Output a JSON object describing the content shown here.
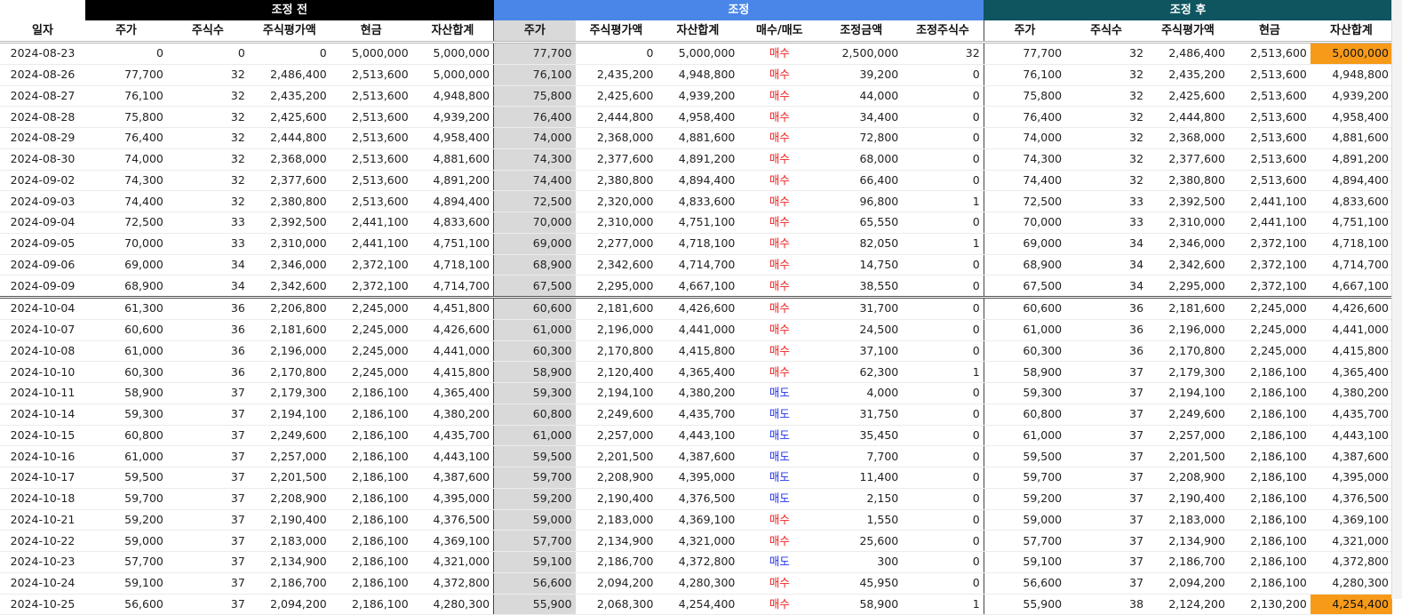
{
  "groups": {
    "before": "조정 전",
    "adjust": "조정",
    "after": "조정 후"
  },
  "headers": [
    "일자",
    "주가",
    "주식수",
    "주식평가액",
    "현금",
    "자산합계",
    "주가",
    "주식평가액",
    "자산합계",
    "매수/매도",
    "조정금액",
    "조정주식수",
    "주가",
    "주식수",
    "주식평가액",
    "현금",
    "자산합계"
  ],
  "colors": {
    "buy": "#ee2222",
    "sell": "#2233ee",
    "highlight": "#f79a1a",
    "group_before": "#000000",
    "group_adjust": "#4a86e8",
    "group_after": "#0e5560"
  },
  "rows": [
    [
      "2024-08-23",
      "0",
      "0",
      "0",
      "5,000,000",
      "5,000,000",
      "77,700",
      "0",
      "5,000,000",
      "매수",
      "2,500,000",
      "32",
      "77,700",
      "32",
      "2,486,400",
      "2,513,600",
      "5,000,000"
    ],
    [
      "2024-08-26",
      "77,700",
      "32",
      "2,486,400",
      "2,513,600",
      "5,000,000",
      "76,100",
      "2,435,200",
      "4,948,800",
      "매수",
      "39,200",
      "0",
      "76,100",
      "32",
      "2,435,200",
      "2,513,600",
      "4,948,800"
    ],
    [
      "2024-08-27",
      "76,100",
      "32",
      "2,435,200",
      "2,513,600",
      "4,948,800",
      "75,800",
      "2,425,600",
      "4,939,200",
      "매수",
      "44,000",
      "0",
      "75,800",
      "32",
      "2,425,600",
      "2,513,600",
      "4,939,200"
    ],
    [
      "2024-08-28",
      "75,800",
      "32",
      "2,425,600",
      "2,513,600",
      "4,939,200",
      "76,400",
      "2,444,800",
      "4,958,400",
      "매수",
      "34,400",
      "0",
      "76,400",
      "32",
      "2,444,800",
      "2,513,600",
      "4,958,400"
    ],
    [
      "2024-08-29",
      "76,400",
      "32",
      "2,444,800",
      "2,513,600",
      "4,958,400",
      "74,000",
      "2,368,000",
      "4,881,600",
      "매수",
      "72,800",
      "0",
      "74,000",
      "32",
      "2,368,000",
      "2,513,600",
      "4,881,600"
    ],
    [
      "2024-08-30",
      "74,000",
      "32",
      "2,368,000",
      "2,513,600",
      "4,881,600",
      "74,300",
      "2,377,600",
      "4,891,200",
      "매수",
      "68,000",
      "0",
      "74,300",
      "32",
      "2,377,600",
      "2,513,600",
      "4,891,200"
    ],
    [
      "2024-09-02",
      "74,300",
      "32",
      "2,377,600",
      "2,513,600",
      "4,891,200",
      "74,400",
      "2,380,800",
      "4,894,400",
      "매수",
      "66,400",
      "0",
      "74,400",
      "32",
      "2,380,800",
      "2,513,600",
      "4,894,400"
    ],
    [
      "2024-09-03",
      "74,400",
      "32",
      "2,380,800",
      "2,513,600",
      "4,894,400",
      "72,500",
      "2,320,000",
      "4,833,600",
      "매수",
      "96,800",
      "1",
      "72,500",
      "33",
      "2,392,500",
      "2,441,100",
      "4,833,600"
    ],
    [
      "2024-09-04",
      "72,500",
      "33",
      "2,392,500",
      "2,441,100",
      "4,833,600",
      "70,000",
      "2,310,000",
      "4,751,100",
      "매수",
      "65,550",
      "0",
      "70,000",
      "33",
      "2,310,000",
      "2,441,100",
      "4,751,100"
    ],
    [
      "2024-09-05",
      "70,000",
      "33",
      "2,310,000",
      "2,441,100",
      "4,751,100",
      "69,000",
      "2,277,000",
      "4,718,100",
      "매수",
      "82,050",
      "1",
      "69,000",
      "34",
      "2,346,000",
      "2,372,100",
      "4,718,100"
    ],
    [
      "2024-09-06",
      "69,000",
      "34",
      "2,346,000",
      "2,372,100",
      "4,718,100",
      "68,900",
      "2,342,600",
      "4,714,700",
      "매수",
      "14,750",
      "0",
      "68,900",
      "34",
      "2,342,600",
      "2,372,100",
      "4,714,700"
    ],
    [
      "2024-09-09",
      "68,900",
      "34",
      "2,342,600",
      "2,372,100",
      "4,714,700",
      "67,500",
      "2,295,000",
      "4,667,100",
      "매수",
      "38,550",
      "0",
      "67,500",
      "34",
      "2,295,000",
      "2,372,100",
      "4,667,100"
    ],
    [
      "2024-10-04",
      "61,300",
      "36",
      "2,206,800",
      "2,245,000",
      "4,451,800",
      "60,600",
      "2,181,600",
      "4,426,600",
      "매수",
      "31,700",
      "0",
      "60,600",
      "36",
      "2,181,600",
      "2,245,000",
      "4,426,600"
    ],
    [
      "2024-10-07",
      "60,600",
      "36",
      "2,181,600",
      "2,245,000",
      "4,426,600",
      "61,000",
      "2,196,000",
      "4,441,000",
      "매수",
      "24,500",
      "0",
      "61,000",
      "36",
      "2,196,000",
      "2,245,000",
      "4,441,000"
    ],
    [
      "2024-10-08",
      "61,000",
      "36",
      "2,196,000",
      "2,245,000",
      "4,441,000",
      "60,300",
      "2,170,800",
      "4,415,800",
      "매수",
      "37,100",
      "0",
      "60,300",
      "36",
      "2,170,800",
      "2,245,000",
      "4,415,800"
    ],
    [
      "2024-10-10",
      "60,300",
      "36",
      "2,170,800",
      "2,245,000",
      "4,415,800",
      "58,900",
      "2,120,400",
      "4,365,400",
      "매수",
      "62,300",
      "1",
      "58,900",
      "37",
      "2,179,300",
      "2,186,100",
      "4,365,400"
    ],
    [
      "2024-10-11",
      "58,900",
      "37",
      "2,179,300",
      "2,186,100",
      "4,365,400",
      "59,300",
      "2,194,100",
      "4,380,200",
      "매도",
      "4,000",
      "0",
      "59,300",
      "37",
      "2,194,100",
      "2,186,100",
      "4,380,200"
    ],
    [
      "2024-10-14",
      "59,300",
      "37",
      "2,194,100",
      "2,186,100",
      "4,380,200",
      "60,800",
      "2,249,600",
      "4,435,700",
      "매도",
      "31,750",
      "0",
      "60,800",
      "37",
      "2,249,600",
      "2,186,100",
      "4,435,700"
    ],
    [
      "2024-10-15",
      "60,800",
      "37",
      "2,249,600",
      "2,186,100",
      "4,435,700",
      "61,000",
      "2,257,000",
      "4,443,100",
      "매도",
      "35,450",
      "0",
      "61,000",
      "37",
      "2,257,000",
      "2,186,100",
      "4,443,100"
    ],
    [
      "2024-10-16",
      "61,000",
      "37",
      "2,257,000",
      "2,186,100",
      "4,443,100",
      "59,500",
      "2,201,500",
      "4,387,600",
      "매도",
      "7,700",
      "0",
      "59,500",
      "37",
      "2,201,500",
      "2,186,100",
      "4,387,600"
    ],
    [
      "2024-10-17",
      "59,500",
      "37",
      "2,201,500",
      "2,186,100",
      "4,387,600",
      "59,700",
      "2,208,900",
      "4,395,000",
      "매도",
      "11,400",
      "0",
      "59,700",
      "37",
      "2,208,900",
      "2,186,100",
      "4,395,000"
    ],
    [
      "2024-10-18",
      "59,700",
      "37",
      "2,208,900",
      "2,186,100",
      "4,395,000",
      "59,200",
      "2,190,400",
      "4,376,500",
      "매도",
      "2,150",
      "0",
      "59,200",
      "37",
      "2,190,400",
      "2,186,100",
      "4,376,500"
    ],
    [
      "2024-10-21",
      "59,200",
      "37",
      "2,190,400",
      "2,186,100",
      "4,376,500",
      "59,000",
      "2,183,000",
      "4,369,100",
      "매수",
      "1,550",
      "0",
      "59,000",
      "37",
      "2,183,000",
      "2,186,100",
      "4,369,100"
    ],
    [
      "2024-10-22",
      "59,000",
      "37",
      "2,183,000",
      "2,186,100",
      "4,369,100",
      "57,700",
      "2,134,900",
      "4,321,000",
      "매수",
      "25,600",
      "0",
      "57,700",
      "37",
      "2,134,900",
      "2,186,100",
      "4,321,000"
    ],
    [
      "2024-10-23",
      "57,700",
      "37",
      "2,134,900",
      "2,186,100",
      "4,321,000",
      "59,100",
      "2,186,700",
      "4,372,800",
      "매도",
      "300",
      "0",
      "59,100",
      "37",
      "2,186,700",
      "2,186,100",
      "4,372,800"
    ],
    [
      "2024-10-24",
      "59,100",
      "37",
      "2,186,700",
      "2,186,100",
      "4,372,800",
      "56,600",
      "2,094,200",
      "4,280,300",
      "매수",
      "45,950",
      "0",
      "56,600",
      "37",
      "2,094,200",
      "2,186,100",
      "4,280,300"
    ],
    [
      "2024-10-25",
      "56,600",
      "37",
      "2,094,200",
      "2,186,100",
      "4,280,300",
      "55,900",
      "2,068,300",
      "4,254,400",
      "매수",
      "58,900",
      "1",
      "55,900",
      "38",
      "2,124,200",
      "2,130,200",
      "4,254,400"
    ]
  ],
  "highlight_rows": [
    0,
    26
  ],
  "break_after_row": 11
}
